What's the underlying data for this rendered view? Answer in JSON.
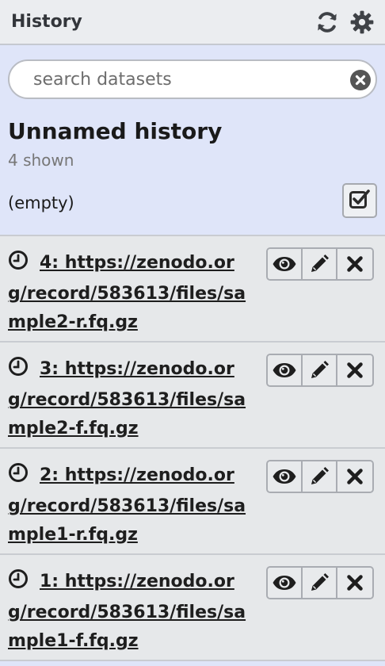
{
  "header": {
    "title": "History"
  },
  "search": {
    "placeholder": "search datasets"
  },
  "history": {
    "name": "Unnamed history",
    "shown": "4 shown",
    "empty_label": "(empty)"
  },
  "datasets": [
    {
      "hid": "4",
      "title": "4: https://zenodo.org/record/583613/files/sample2-r.fq.gz "
    },
    {
      "hid": "3",
      "title": "3: https://zenodo.org/record/583613/files/sample2-f.fq.gz "
    },
    {
      "hid": "2",
      "title": "2: https://zenodo.org/record/583613/files/sample1-r.fq.gz "
    },
    {
      "hid": "1",
      "title": "1: https://zenodo.org/record/583613/files/sample1-f.fq.gz "
    }
  ],
  "icons": [
    "refresh-icon",
    "gear-icon",
    "clear-search-icon",
    "select-checkbox-icon",
    "clock-icon",
    "eye-icon",
    "pencil-icon",
    "delete-icon"
  ],
  "colors": {
    "header_bg": "#ebedf0",
    "controls_bg": "#dfe5f9",
    "dataset_bg": "#e6e8ea"
  }
}
